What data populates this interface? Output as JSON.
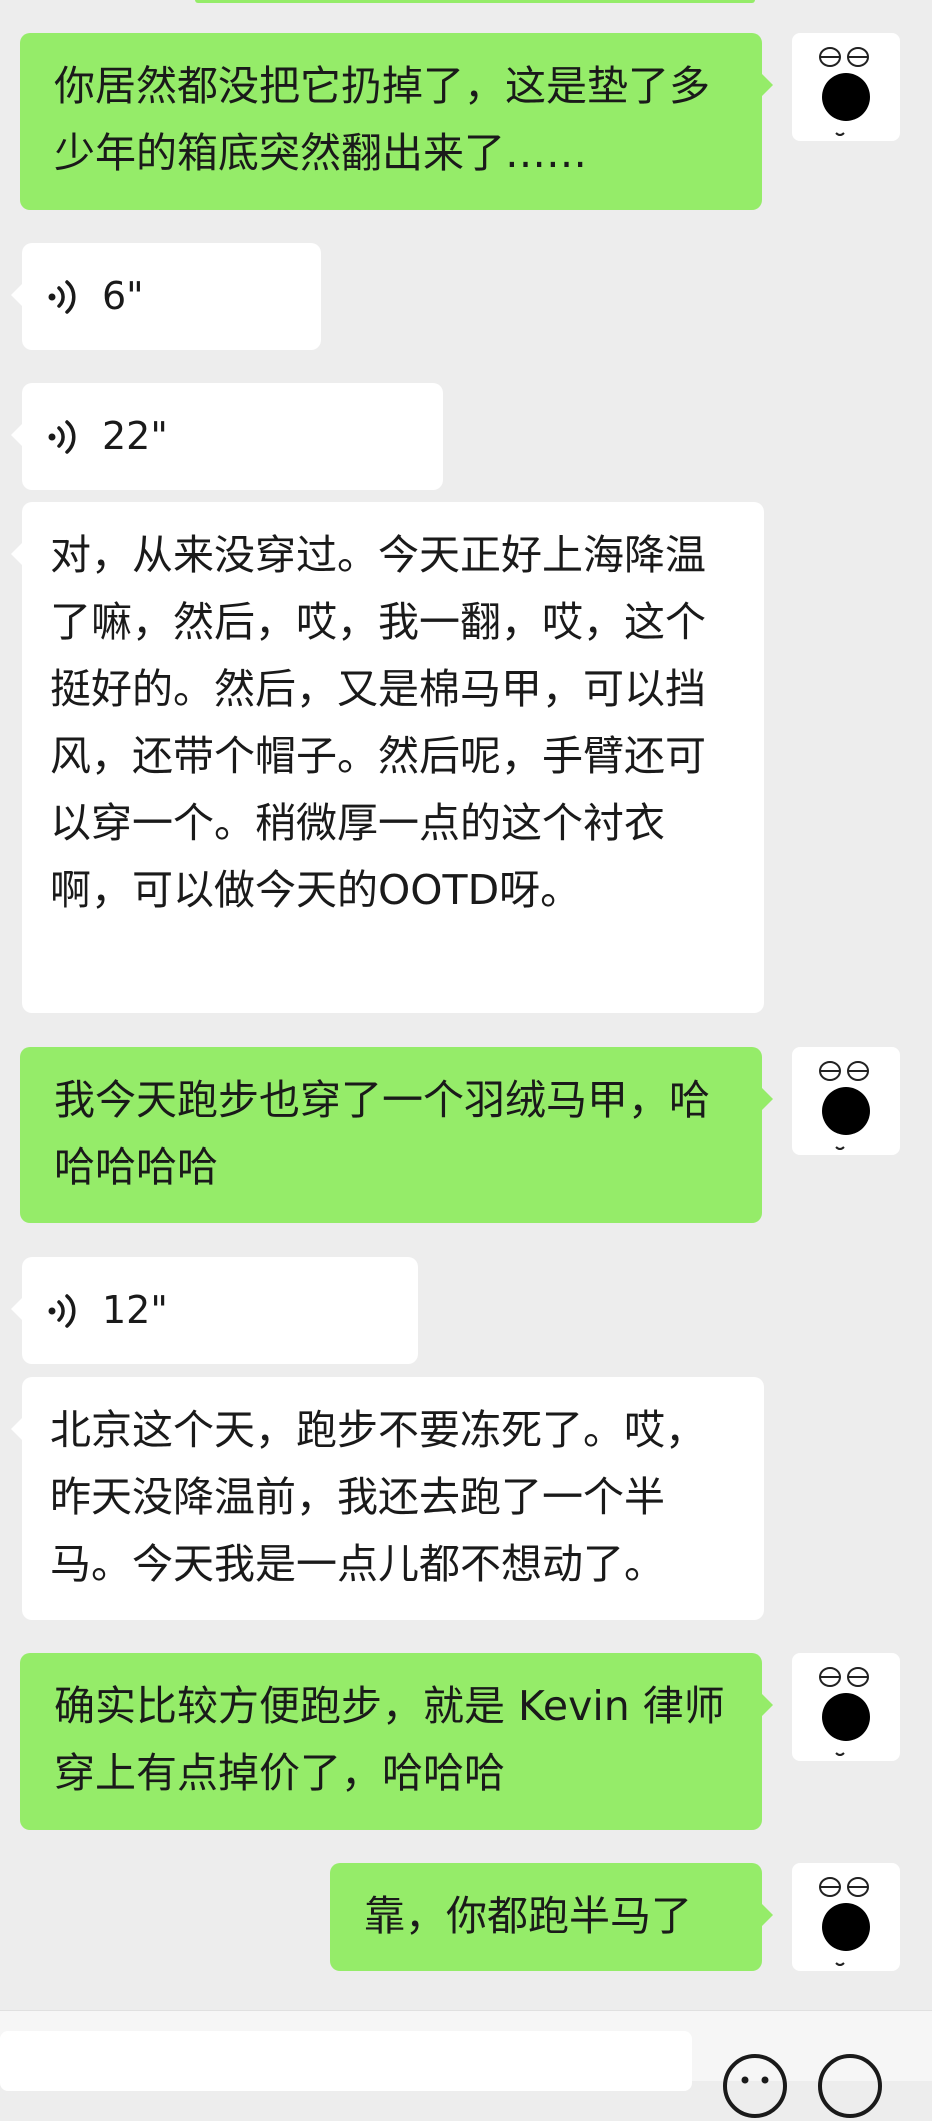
{
  "chat": {
    "messages": [
      {
        "id": "m1",
        "direction": "out",
        "type": "text",
        "text": "你居然都没把它扔掉了，这是垫了多少年的箱底突然翻出来了……"
      },
      {
        "id": "m2",
        "direction": "in",
        "type": "voice",
        "duration": "6\""
      },
      {
        "id": "m3",
        "direction": "in",
        "type": "voice",
        "duration": "22\""
      },
      {
        "id": "m4",
        "direction": "in",
        "type": "text",
        "text": "对，从来没穿过。今天正好上海降温了嘛，然后，哎，我一翻，哎，这个挺好的。然后，又是棉马甲，可以挡风，还带个帽子。然后呢，手臂还可以穿一个。稍微厚一点的这个衬衣啊，可以做今天的OOTD呀。"
      },
      {
        "id": "m5",
        "direction": "out",
        "type": "text",
        "text": "我今天跑步也穿了一个羽绒马甲，哈哈哈哈哈"
      },
      {
        "id": "m6",
        "direction": "in",
        "type": "voice",
        "duration": "12\""
      },
      {
        "id": "m7",
        "direction": "in",
        "type": "text",
        "text": "北京这个天，跑步不要冻死了。哎，昨天没降温前，我还去跑了一个半马。今天我是一点儿都不想动了。"
      },
      {
        "id": "m8",
        "direction": "out",
        "type": "text",
        "text": "确实比较方便跑步，就是 Kevin 律师穿上有点掉价了，哈哈哈"
      },
      {
        "id": "m9",
        "direction": "out",
        "type": "text",
        "text": "靠，你都跑半马了"
      }
    ]
  },
  "icons": {
    "voice": "voice-wave-icon",
    "avatar": "face-avatar-icon",
    "emoji": "emoji-icon",
    "more": "plus-icon"
  },
  "colors": {
    "background": "#ededed",
    "incoming_bubble": "#ffffff",
    "outgoing_bubble": "#95ec69",
    "text": "#1a1a1a"
  }
}
